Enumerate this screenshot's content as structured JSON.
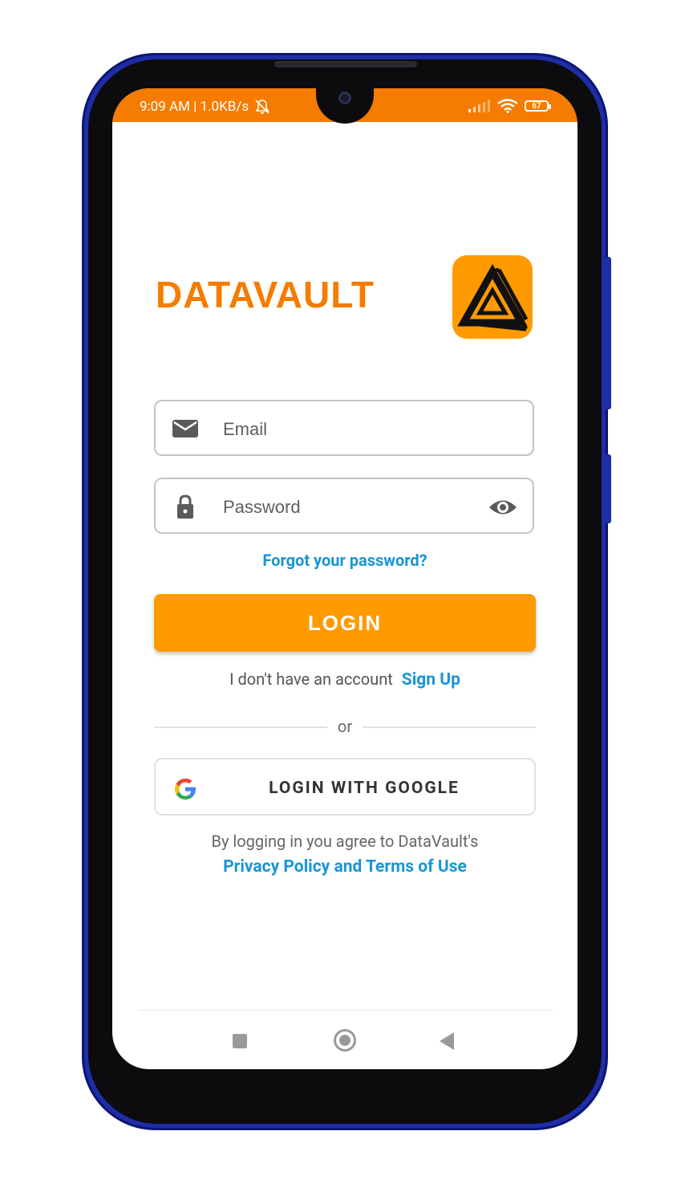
{
  "status_bar": {
    "time_speed": "9:09 AM | 1.0KB/s",
    "battery_level": "67",
    "icons": [
      "mute-bell-icon",
      "signal-icon",
      "wifi-icon",
      "battery-icon"
    ]
  },
  "brand": {
    "name": "DATAVAULT",
    "logo_icon": "datavault-triangle-logo",
    "color": "#f57c00"
  },
  "login_form": {
    "email_placeholder": "Email",
    "password_placeholder": "Password",
    "forgot_password": "Forgot your password?",
    "login_button": "LOGIN",
    "no_account_text": "I don't have an account",
    "sign_up_link": "Sign Up",
    "or_text": "or",
    "google_button": "LOGIN WITH GOOGLE",
    "agree_text": "By logging in you agree to DataVault's",
    "policy_link": "Privacy Policy and Terms of Use"
  },
  "colors": {
    "accent": "#ff9a00",
    "link": "#1a95d6",
    "status_bar": "#f57c00"
  },
  "nav_bar": {
    "icons": [
      "recent-apps-icon",
      "home-icon",
      "back-icon"
    ]
  }
}
